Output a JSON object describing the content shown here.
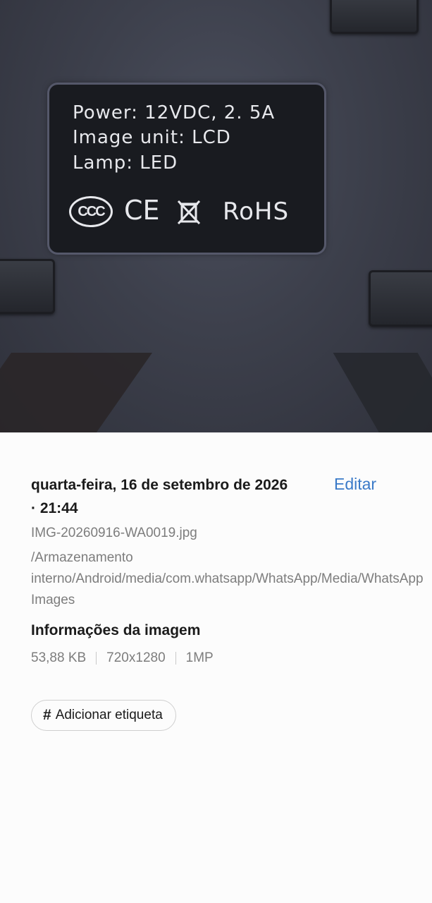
{
  "photo": {
    "plate": {
      "power": "Power: 12VDC, 2. 5A",
      "image_unit": "Image unit: LCD",
      "lamp": "Lamp: LED",
      "ccc_mark": "CCC",
      "ce_mark": "CE",
      "weee_icon": "crossed-out-bin-icon",
      "rohs_mark": "RoHS"
    }
  },
  "details": {
    "date_line1": "quarta-feira, 16 de setembro de 2026",
    "date_line2": "· 21:44",
    "edit_label": "Editar",
    "file_name": "IMG-20260916-WA0019.jpg",
    "file_path": "/Armazenamento interno/Android/media/com.whatsapp/WhatsApp/Media/WhatsApp Images"
  },
  "image_info": {
    "title": "Informações da imagem",
    "size": "53,88 KB",
    "resolution": "720x1280",
    "megapixels": "1MP"
  },
  "tag": {
    "hash": "#",
    "label": "Adicionar etiqueta"
  },
  "colors": {
    "accent": "#3a7ac8",
    "text_primary": "#1b1b1b",
    "text_secondary": "#7d7d7d"
  }
}
